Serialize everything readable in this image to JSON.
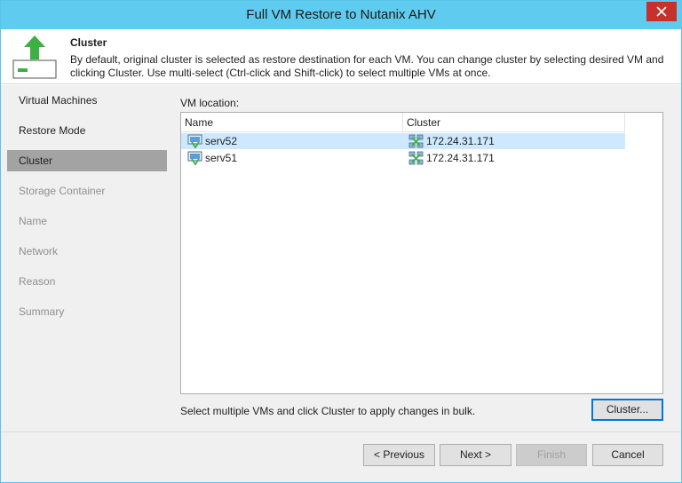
{
  "window": {
    "title": "Full VM Restore to Nutanix AHV",
    "close_icon": "close-icon"
  },
  "header": {
    "title": "Cluster",
    "description": "By default, original cluster is selected as restore destination for each VM. You can change cluster by selecting desired VM and clicking Cluster. Use multi-select (Ctrl-click and Shift-click) to select multiple VMs at once.",
    "icon": "restore-arrow-icon",
    "accent_color": "#3cb043"
  },
  "nav": {
    "items": [
      {
        "label": "Virtual Machines",
        "state": "normal"
      },
      {
        "label": "Restore Mode",
        "state": "normal"
      },
      {
        "label": "Cluster",
        "state": "active"
      },
      {
        "label": "Storage Container",
        "state": "disabled"
      },
      {
        "label": "Name",
        "state": "disabled"
      },
      {
        "label": "Network",
        "state": "disabled"
      },
      {
        "label": "Reason",
        "state": "disabled"
      },
      {
        "label": "Summary",
        "state": "disabled"
      }
    ]
  },
  "content": {
    "vm_location_label": "VM location:",
    "columns": {
      "name": "Name",
      "cluster": "Cluster"
    },
    "rows": [
      {
        "name": "serv52",
        "cluster": "172.24.31.171",
        "selected": true
      },
      {
        "name": "serv51",
        "cluster": "172.24.31.171",
        "selected": false
      }
    ],
    "hint": "Select multiple VMs and click Cluster to apply changes in bulk.",
    "cluster_button": "Cluster..."
  },
  "footer": {
    "previous": "< Previous",
    "next": "Next >",
    "finish": "Finish",
    "cancel": "Cancel"
  }
}
